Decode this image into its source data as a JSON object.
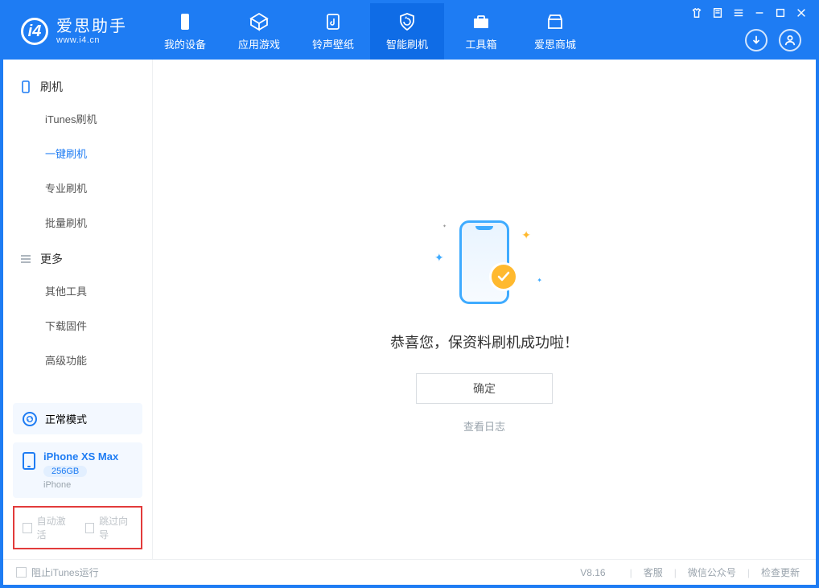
{
  "brand": {
    "name": "爱思助手",
    "url": "www.i4.cn"
  },
  "nav": {
    "tabs": [
      {
        "label": "我的设备"
      },
      {
        "label": "应用游戏"
      },
      {
        "label": "铃声壁纸"
      },
      {
        "label": "智能刷机"
      },
      {
        "label": "工具箱"
      },
      {
        "label": "爱思商城"
      }
    ]
  },
  "sidebar": {
    "groups": [
      {
        "title": "刷机",
        "items": [
          {
            "label": "iTunes刷机"
          },
          {
            "label": "一键刷机"
          },
          {
            "label": "专业刷机"
          },
          {
            "label": "批量刷机"
          }
        ]
      },
      {
        "title": "更多",
        "items": [
          {
            "label": "其他工具"
          },
          {
            "label": "下载固件"
          },
          {
            "label": "高级功能"
          }
        ]
      }
    ],
    "status_label": "正常模式",
    "device": {
      "name": "iPhone XS Max",
      "capacity": "256GB",
      "type": "iPhone"
    },
    "checkboxes": {
      "auto_activate": "自动激活",
      "skip_guide": "跳过向导"
    }
  },
  "main": {
    "success_title": "恭喜您，保资料刷机成功啦！",
    "ok_button": "确定",
    "view_log": "查看日志"
  },
  "footer": {
    "block_itunes": "阻止iTunes运行",
    "version": "V8.16",
    "links": [
      "客服",
      "微信公众号",
      "检查更新"
    ]
  }
}
